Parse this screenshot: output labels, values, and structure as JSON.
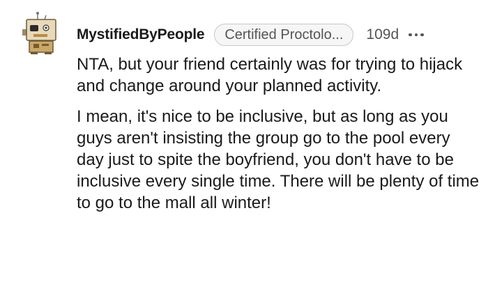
{
  "comment": {
    "author": "MystifiedByPeople",
    "flair": "Certified Proctolo...",
    "age": "109d",
    "paragraphs": [
      "NTA, but your friend certainly was for trying to hijack and change around your planned activity.",
      "I mean, it's nice to be inclusive, but as long as you guys aren't insisting the group go to the pool every day just to spite the boyfriend, you don't have to be inclusive every single time. There will be plenty of time to go to the mall all winter!"
    ]
  },
  "icons": {
    "avatar": "robot-avatar-icon",
    "more": "more-options-icon"
  }
}
